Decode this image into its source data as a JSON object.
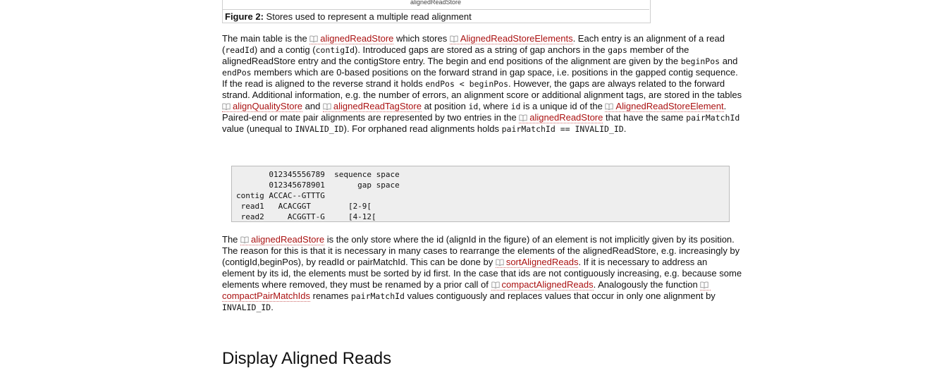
{
  "figure": {
    "top_sliver_text": "alignedReadStore",
    "caption_label": "Figure 2:",
    "caption_text": "Stores used to represent a multiple read alignment"
  },
  "para1": {
    "t1": "The main table is the ",
    "link_alignedReadStore": "alignedReadStore",
    "t2": " which stores ",
    "link_AlignedReadStoreElements": "AlignedReadStoreElements",
    "t3": ". Each entry is an alignment of a read (",
    "code_readId": "readId",
    "t4": ") and a contig (",
    "code_contigId": "contigId",
    "t5": "). Introduced gaps are stored as a string of gap anchors in the ",
    "code_gaps": "gaps",
    "t6": " member of the alignedReadStore entry and the contigStore entry. The begin and end positions of the alignment are given by the ",
    "code_beginPos": "beginPos",
    "t7": " and ",
    "code_endPos": "endPos",
    "t8": " members which are 0-based positions on the forward strand in gap space, i.e. positions in the gapped contig sequence. If the read is aligned to the reverse strand it holds ",
    "code_cond": "endPos < beginPos",
    "t9": ". However, the gaps are always related to the forward strand. Additional information, e.g. the number of errors, an alignment score or additional alignment tags, are stored in the tables ",
    "link_alignQualityStore": "alignQualityStore",
    "t10": " and ",
    "link_alignedReadTagStore": "alignedReadTagStore",
    "t11": " at position ",
    "code_id1": "id",
    "t12": ", where ",
    "code_id2": "id",
    "t13": " is a unique id of the ",
    "link_AlignedReadStoreElement": "AlignedReadStoreElement",
    "t14": ". Paired-end or mate pair alignments are represented by two entries in the ",
    "link_alignedReadStore2": "alignedReadStore",
    "t15": " that have the same ",
    "code_pairMatchId": "pairMatchId",
    "t16": " value (unequal to ",
    "code_INVALID_ID": "INVALID_ID",
    "t17": "). For orphaned read alignments holds ",
    "code_cond2": "pairMatchId == INVALID_ID",
    "t18": "."
  },
  "code_block": "       012345556789  sequence space\n       012345678901       gap space\ncontig ACCAC--GTTTG\n read1   ACACGGT        [2-9[\n read2     ACGGTT-G     [4-12[",
  "para2": {
    "t1": "The ",
    "link_alignedReadStore": "alignedReadStore",
    "t2": " is the only store where the id (alignId in the figure) of an element is not implicitly given by its position. The reason for this is that it is necessary in many cases to rearrange the elements of the alignedReadStore, e.g. increasingly by (contigId,beginPos), by readId or pairMatchId. This can be done by ",
    "link_sortAlignedReads": "sortAlignedReads",
    "t3": ". If it is necessary to address an element by its id, the elements must be sorted by id first. In the case that ids are not contiguously increasing, e.g. because some elements where removed, they must be renamed by a prior call of ",
    "link_compactAlignedReads": "compactAlignedReads",
    "t4": ". Analogously the function ",
    "link_compactPairMatchIds": "compactPairMatchIds",
    "t5": " renames ",
    "code_pairMatchId": "pairMatchId",
    "t6": " values contiguously and replaces values that occur in only one alignment by ",
    "code_INVALID_ID": "INVALID_ID",
    "t7": "."
  },
  "section_heading": "Display Aligned Reads",
  "colors": {
    "link": "#aa1111",
    "code_bg": "#eeeeee"
  },
  "icons": {
    "link_icon": "book-icon"
  }
}
